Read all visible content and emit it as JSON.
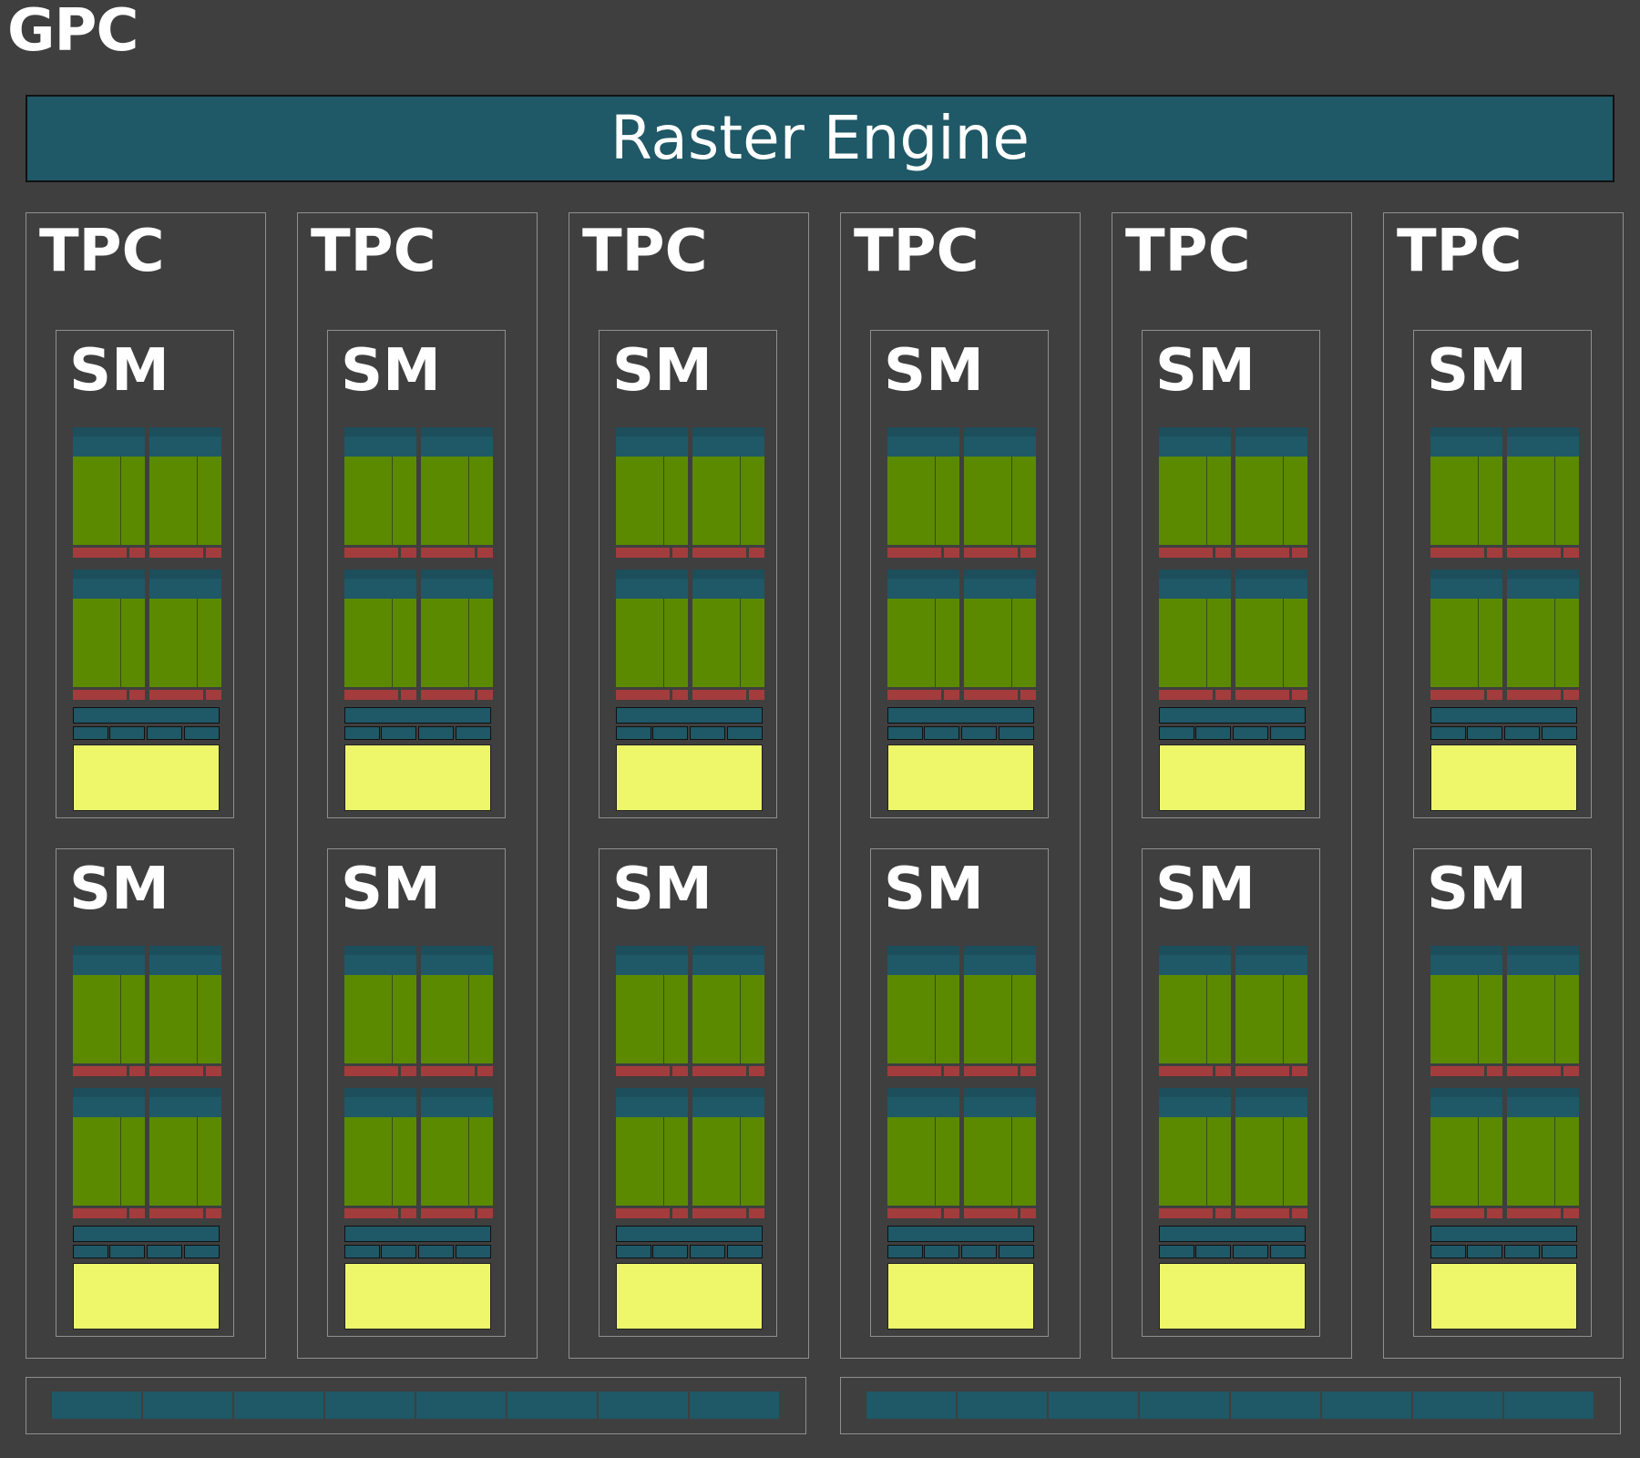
{
  "gpc": {
    "title": "GPC",
    "raster_engine": "Raster Engine",
    "tpcs": [
      {
        "label": "TPC",
        "sms": [
          {
            "label": "SM"
          },
          {
            "label": "SM"
          }
        ]
      },
      {
        "label": "TPC",
        "sms": [
          {
            "label": "SM"
          },
          {
            "label": "SM"
          }
        ]
      },
      {
        "label": "TPC",
        "sms": [
          {
            "label": "SM"
          },
          {
            "label": "SM"
          }
        ]
      },
      {
        "label": "TPC",
        "sms": [
          {
            "label": "SM"
          },
          {
            "label": "SM"
          }
        ]
      },
      {
        "label": "TPC",
        "sms": [
          {
            "label": "SM"
          },
          {
            "label": "SM"
          }
        ]
      },
      {
        "label": "TPC",
        "sms": [
          {
            "label": "SM"
          },
          {
            "label": "SM"
          }
        ]
      }
    ],
    "shared_blocks": [
      {
        "units": 8
      },
      {
        "units": 8
      }
    ]
  },
  "colors": {
    "background": "#3f3f3f",
    "teal": "#1f5866",
    "green": "#5b8a00",
    "red": "#a33c3c",
    "yellow": "#eef76a",
    "border": "#8f8f8f"
  }
}
